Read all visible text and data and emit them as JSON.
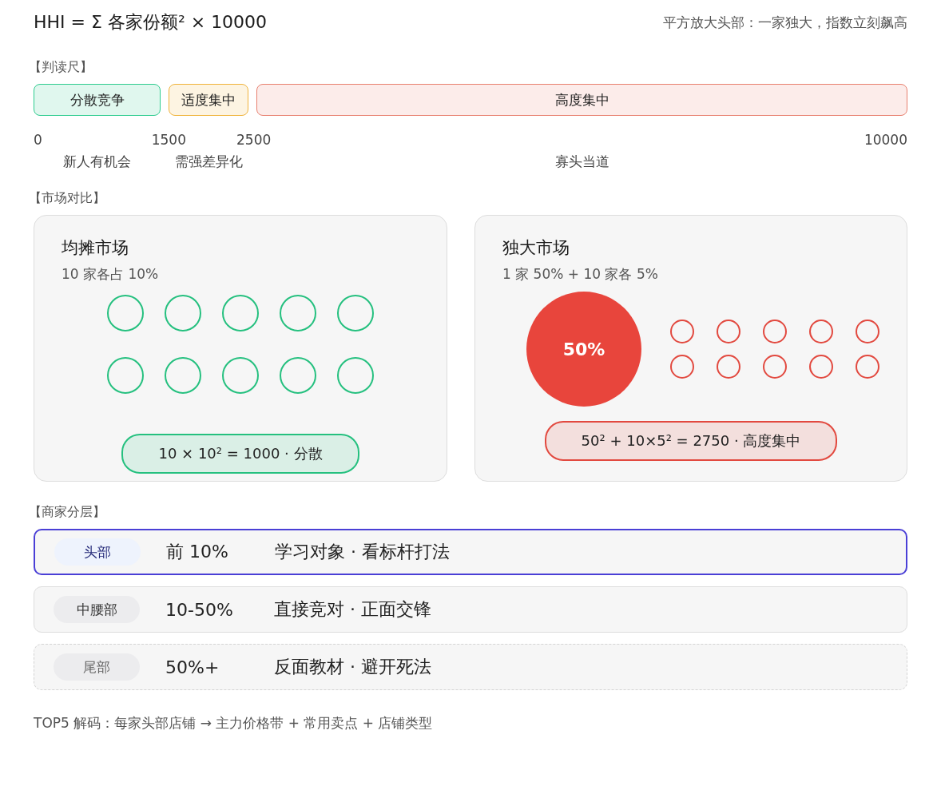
{
  "header": {
    "formula": "HHI = Σ 各家份额² × 10000",
    "note": "平方放大头部：一家独大，指数立刻飙高"
  },
  "scale": {
    "title": "【判读尺】",
    "segments": [
      {
        "label": "分散竞争",
        "color": "#2ecc8f",
        "caption": "新人有机会"
      },
      {
        "label": "适度集中",
        "color": "#f0b43c",
        "caption": "需强差异化"
      },
      {
        "label": "高度集中",
        "color": "#e8806f",
        "caption": "寡头当道"
      }
    ],
    "ticks": [
      "0",
      "1500",
      "2500",
      "10000"
    ]
  },
  "compare": {
    "title": "【市场对比】",
    "markets": [
      {
        "kind": "equal",
        "title": "均摊市场",
        "subtitle": "10 家各占 10%",
        "formula": "10 × 10² = 1000 · 分散"
      },
      {
        "kind": "dominant",
        "title": "独大市场",
        "subtitle": "1 家 50% + 10 家各 5%",
        "big_label": "50%",
        "formula": "50² + 10×5² = 2750 · 高度集中"
      }
    ]
  },
  "tiers": {
    "title": "【商家分层】",
    "rows": [
      {
        "badge": "头部",
        "range": "前 10%",
        "desc": "学习对象 · 看标杆打法",
        "selected": true,
        "kind": "solid"
      },
      {
        "badge": "中腰部",
        "range": "10-50%",
        "desc": "直接竞对 · 正面交锋",
        "selected": false,
        "kind": "solid"
      },
      {
        "badge": "尾部",
        "range": "50%+",
        "desc": "反面教材 · 避开死法",
        "selected": false,
        "kind": "dashed"
      }
    ]
  },
  "footer": "TOP5 解码：每家头部店铺 → 主力价格带 + 常用卖点 + 店铺类型"
}
